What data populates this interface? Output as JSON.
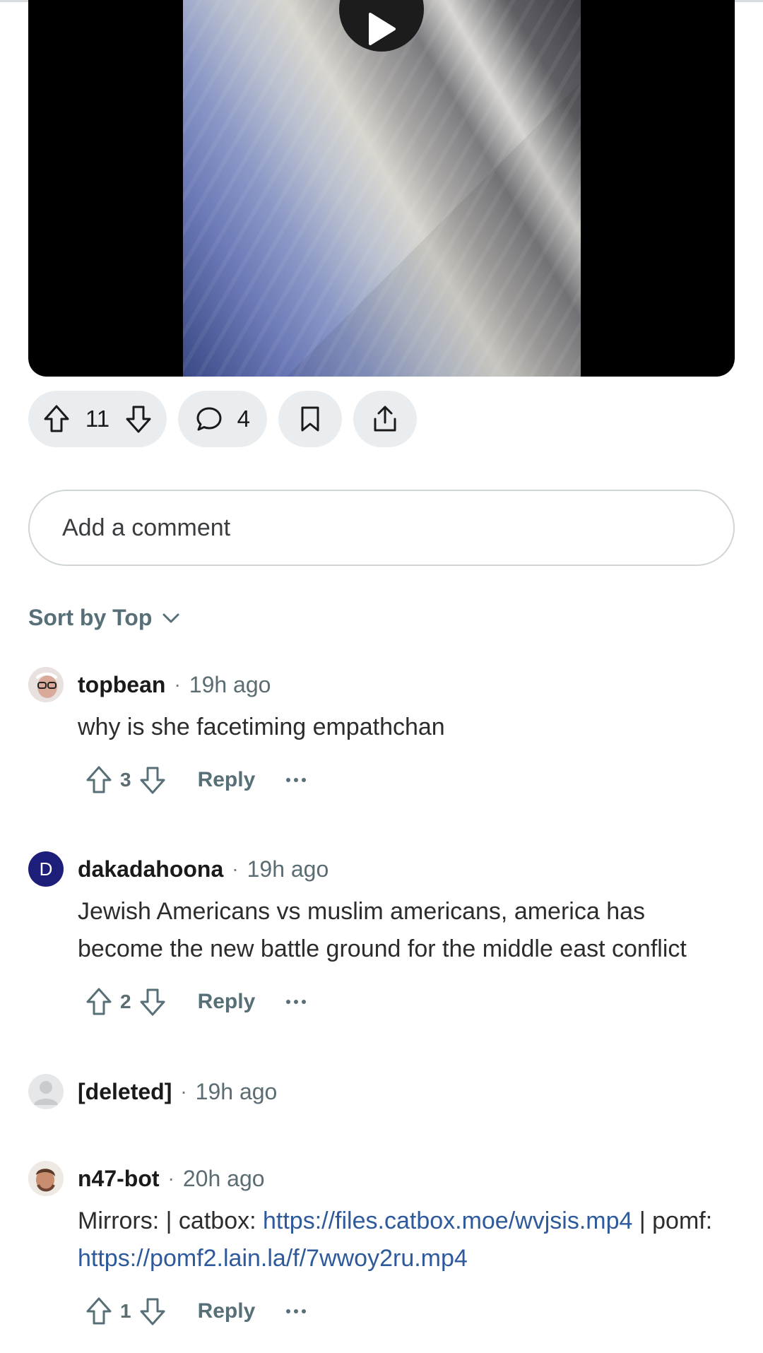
{
  "post": {
    "upvotes": "11",
    "comment_count": "4"
  },
  "add_comment_placeholder": "Add a comment",
  "sort_label": "Sort by Top",
  "comments": [
    {
      "author": "topbean",
      "time": "19h ago",
      "text": "why is she facetiming empathchan",
      "score": "3",
      "reply_label": "Reply"
    },
    {
      "author": "dakadahoona",
      "avatar_letter": "D",
      "time": "19h ago",
      "text": "Jewish Americans vs muslim americans, america has become the new battle ground for the middle east conflict",
      "score": "2",
      "reply_label": "Reply"
    },
    {
      "author": "[deleted]",
      "time": "19h ago"
    },
    {
      "author": "n47-bot",
      "time": "20h ago",
      "text_prefix": "Mirrors: | catbox: ",
      "link1": "https://files.catbox.moe/wvjsis.mp4",
      "text_mid": " | pomf: ",
      "link2": "https://pomf2.lain.la/f/7wwoy2ru.mp4",
      "score": "1",
      "reply_label": "Reply"
    }
  ],
  "colors": {
    "link": "#2e5a9b",
    "pill_bg": "#eaedef",
    "avatar_d": "#1d1d7a"
  }
}
